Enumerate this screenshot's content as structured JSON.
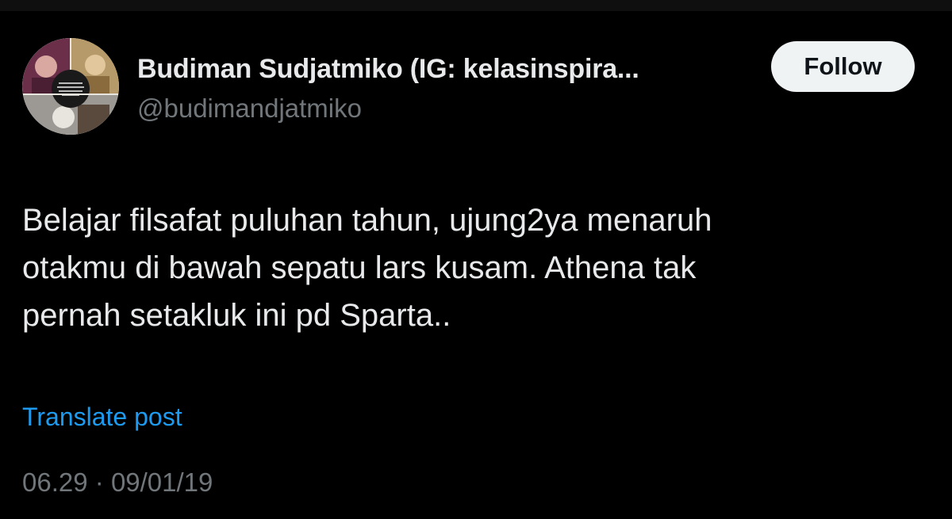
{
  "author": {
    "display_name": "Budiman Sudjatmiko (IG: kelasinspira...",
    "handle": "@budimandjatmiko",
    "avatar_icon": "collage-avatar-icon"
  },
  "actions": {
    "follow_label": "Follow"
  },
  "post": {
    "text": "Belajar filsafat puluhan tahun, ujung2ya menaruh\notakmu di bawah sepatu lars kusam. Athena tak\npernah setakluk ini pd Sparta..",
    "translate_label": "Translate post",
    "time": "06.29",
    "separator": "·",
    "date": "09/01/19"
  },
  "colors": {
    "background": "#000000",
    "primary_text": "#e7e9ea",
    "secondary_text": "#71767b",
    "link": "#1d9bf0",
    "follow_button_bg": "#eff3f4"
  }
}
